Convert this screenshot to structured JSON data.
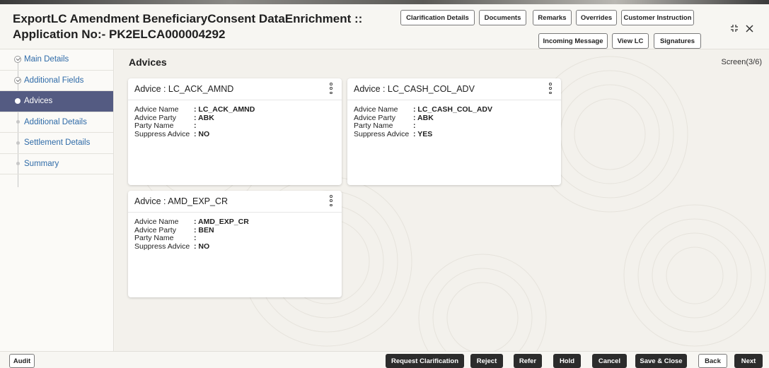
{
  "header": {
    "title_line1": "ExportLC Amendment BeneficiaryConsent DataEnrichment ::",
    "title_line2": "Application No:- PK2ELCA000004292",
    "buttons_row1": [
      "Clarification Details",
      "Documents",
      "Remarks",
      "Overrides",
      "Customer Instruction"
    ],
    "buttons_row2": [
      "Incoming Message",
      "View LC",
      "Signatures"
    ]
  },
  "sidebar": {
    "items": [
      {
        "label": "Main Details",
        "state": "done"
      },
      {
        "label": "Additional Fields",
        "state": "done"
      },
      {
        "label": "Advices",
        "state": "active"
      },
      {
        "label": "Additional Details",
        "state": "pending"
      },
      {
        "label": "Settlement Details",
        "state": "pending"
      },
      {
        "label": "Summary",
        "state": "pending"
      }
    ]
  },
  "main": {
    "section_title": "Advices",
    "screen_count": "Screen(3/6)",
    "field_labels": {
      "advice_name": "Advice Name",
      "advice_party": "Advice Party",
      "party_name": "Party Name",
      "suppress_advice": "Suppress Advice"
    },
    "cards": [
      {
        "title": "Advice : LC_ACK_AMND",
        "advice_name": ": LC_ACK_AMND",
        "advice_party": ": ABK",
        "party_name": ":",
        "suppress_advice": ": NO"
      },
      {
        "title": "Advice : LC_CASH_COL_ADV",
        "advice_name": ": LC_CASH_COL_ADV",
        "advice_party": ": ABK",
        "party_name": ":",
        "suppress_advice": ": YES"
      },
      {
        "title": "Advice : AMD_EXP_CR",
        "advice_name": ": AMD_EXP_CR",
        "advice_party": ": BEN",
        "party_name": ":",
        "suppress_advice": ": NO"
      }
    ]
  },
  "footer": {
    "audit": "Audit",
    "request_clarification": "Request Clarification",
    "reject": "Reject",
    "refer": "Refer",
    "hold": "Hold",
    "cancel": "Cancel",
    "save_close": "Save & Close",
    "back": "Back",
    "next": "Next"
  },
  "colors": {
    "active_nav": "#545b82",
    "link": "#2f6ba8",
    "dark_button": "#2c2c2c"
  }
}
